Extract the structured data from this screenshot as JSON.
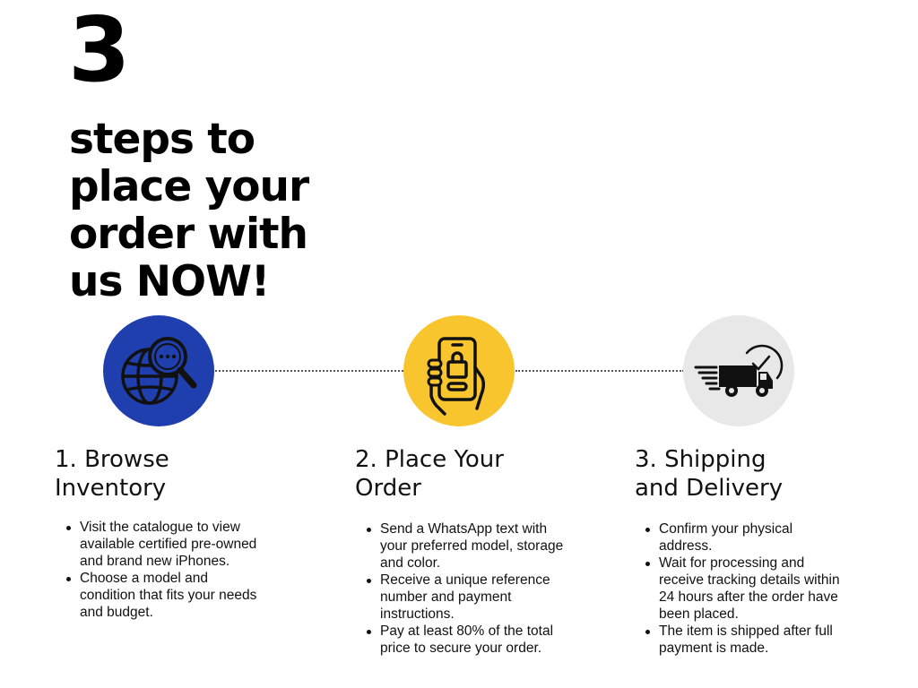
{
  "hero": {
    "number": "3",
    "headline_lines": [
      "steps to",
      "place your",
      "order with",
      "us NOW!"
    ]
  },
  "colors": {
    "step1_circle": "#1F3FAF",
    "step2_circle": "#F9C52F",
    "step3_circle": "#E8E8E8",
    "text": "#111111"
  },
  "steps": [
    {
      "icon": "globe-search-icon",
      "title_lines": [
        "1. Browse",
        "Inventory"
      ],
      "bullets": [
        "Visit the catalogue to view available certified pre-owned and brand new iPhones.",
        "Choose a model and condition that fits your needs and budget."
      ]
    },
    {
      "icon": "phone-shopping-bag-icon",
      "title_lines": [
        "2. Place Your",
        "Order"
      ],
      "bullets": [
        "Send a WhatsApp text with your preferred model, storage and color.",
        "Receive a unique reference number and payment instructions.",
        "Pay at least 80% of the total price to secure your order."
      ]
    },
    {
      "icon": "fast-delivery-truck-icon",
      "title_lines": [
        "3. Shipping",
        "and Delivery"
      ],
      "bullets": [
        "Confirm your physical address.",
        "Wait for processing and receive tracking details within 24 hours after the order have been placed.",
        "The item is shipped after full payment is made."
      ]
    }
  ]
}
